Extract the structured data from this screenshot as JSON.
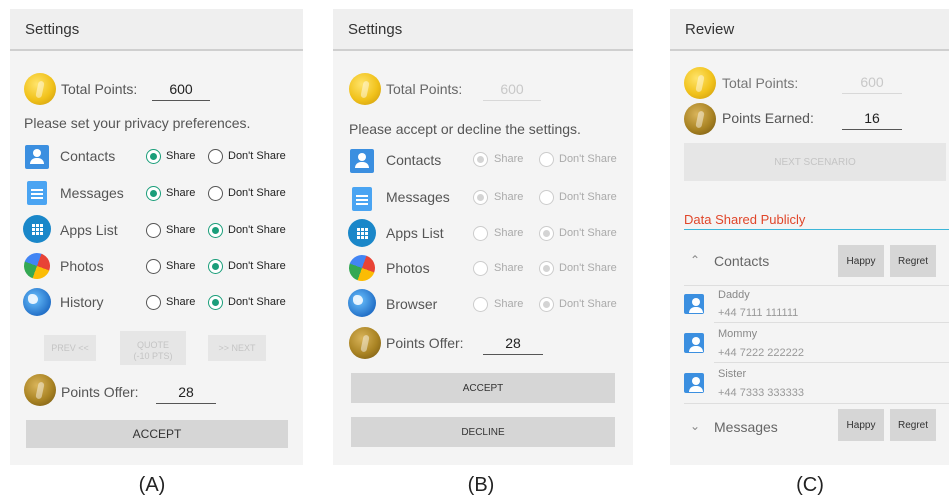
{
  "panel_a": {
    "title": "Settings",
    "total_points_label": "Total Points:",
    "total_points_value": "600",
    "instruction": "Please set your privacy preferences.",
    "rows": [
      {
        "label": "Contacts",
        "share": "Share",
        "dont_share": "Don't Share",
        "choice": "share",
        "icon": "contacts-icon"
      },
      {
        "label": "Messages",
        "share": "Share",
        "dont_share": "Don't Share",
        "choice": "share",
        "icon": "messages-icon"
      },
      {
        "label": "Apps List",
        "share": "Share",
        "dont_share": "Don't Share",
        "choice": "dont_share",
        "icon": "apps-icon"
      },
      {
        "label": "Photos",
        "share": "Share",
        "dont_share": "Don't Share",
        "choice": "dont_share",
        "icon": "photos-icon"
      },
      {
        "label": "History",
        "share": "Share",
        "dont_share": "Don't Share",
        "choice": "dont_share",
        "icon": "globe-icon"
      }
    ],
    "prev_label": "PREV <<",
    "quote_label": "QUOTE",
    "quote_sub": "(-10 PTS)",
    "next_label": ">> NEXT",
    "points_offer_label": "Points Offer:",
    "points_offer_value": "28",
    "accept_label": "ACCEPT",
    "caption": "(A)"
  },
  "panel_b": {
    "title": "Settings",
    "total_points_label": "Total Points:",
    "total_points_value": "600",
    "instruction": "Please accept or decline the settings.",
    "rows": [
      {
        "label": "Contacts",
        "share": "Share",
        "dont_share": "Don't Share",
        "choice": "share",
        "icon": "contacts-icon"
      },
      {
        "label": "Messages",
        "share": "Share",
        "dont_share": "Don't Share",
        "choice": "share",
        "icon": "messages-icon"
      },
      {
        "label": "Apps List",
        "share": "Share",
        "dont_share": "Don't Share",
        "choice": "dont_share",
        "icon": "apps-icon"
      },
      {
        "label": "Photos",
        "share": "Share",
        "dont_share": "Don't Share",
        "choice": "dont_share",
        "icon": "photos-icon"
      },
      {
        "label": "Browser",
        "share": "Share",
        "dont_share": "Don't Share",
        "choice": "dont_share",
        "icon": "globe-icon"
      }
    ],
    "points_offer_label": "Points Offer:",
    "points_offer_value": "28",
    "accept_label": "ACCEPT",
    "decline_label": "DECLINE",
    "caption": "(B)"
  },
  "panel_c": {
    "title": "Review",
    "total_points_label": "Total Points:",
    "total_points_value": "600",
    "points_earned_label": "Points Earned:",
    "points_earned_value": "16",
    "next_scenario_label": "NEXT SCENARIO",
    "section_title": "Data Shared Publicly",
    "contacts_label": "Contacts",
    "messages_label": "Messages",
    "happy_label": "Happy",
    "regret_label": "Regret",
    "entries": [
      {
        "name": "Daddy",
        "phone": "+44 7111 111111"
      },
      {
        "name": "Mommy",
        "phone": "+44 7222 222222"
      },
      {
        "name": "Sister",
        "phone": "+44 7333 333333"
      }
    ],
    "caption": "(C)"
  }
}
